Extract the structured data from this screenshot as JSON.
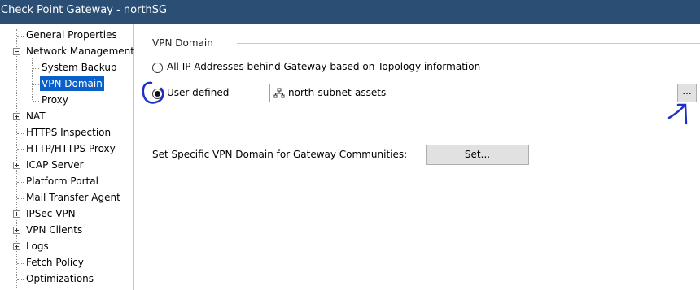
{
  "window": {
    "title": "Check Point Gateway - northSG"
  },
  "tree": {
    "items": [
      {
        "label": "General Properties"
      },
      {
        "label": "Network Management"
      },
      {
        "label": "System Backup"
      },
      {
        "label": "VPN Domain"
      },
      {
        "label": "Proxy"
      },
      {
        "label": "NAT"
      },
      {
        "label": "HTTPS Inspection"
      },
      {
        "label": "HTTP/HTTPS Proxy"
      },
      {
        "label": "ICAP Server"
      },
      {
        "label": "Platform Portal"
      },
      {
        "label": "Mail Transfer Agent"
      },
      {
        "label": "IPSec VPN"
      },
      {
        "label": "VPN Clients"
      },
      {
        "label": "Logs"
      },
      {
        "label": "Fetch Policy"
      },
      {
        "label": "Optimizations"
      }
    ],
    "selected": "VPN Domain"
  },
  "panel": {
    "group_title": "VPN Domain",
    "option_topology": "All IP Addresses behind Gateway based on Topology information",
    "option_user_defined": "User defined",
    "selected_option": "User defined",
    "domain_value": "north-subnet-assets",
    "browse_label": "...",
    "communities_label": "Set Specific VPN Domain for Gateway Communities:",
    "set_label": "Set..."
  },
  "colors": {
    "titlebar": "#2b4e74",
    "selection": "#0a5fc8",
    "annotation_ink": "#1f2fc9"
  },
  "icons": {
    "field_icon": "network-group-icon",
    "expand_icon": "plus-box-icon",
    "collapse_icon": "minus-box-icon"
  }
}
